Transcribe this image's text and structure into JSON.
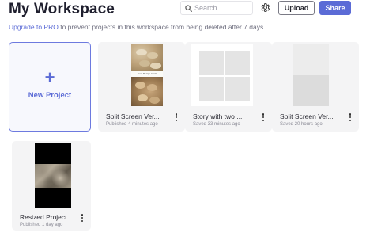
{
  "header": {
    "title": "My Workspace",
    "search_placeholder": "Search",
    "upload_label": "Upload",
    "share_label": "Share"
  },
  "notice": {
    "link_text": "Upgrade to PRO",
    "text": " to prevent projects in this workspace from being deleted after 7 days."
  },
  "new_project": {
    "plus": "+",
    "label": "New Project"
  },
  "projects": [
    {
      "name": "Split Screen Ver...",
      "meta": "Published 4 minutes ago",
      "thumb_caption": "How Recipe Alert!"
    },
    {
      "name": "Story with two ...",
      "meta": "Saved 33 minutes ago"
    },
    {
      "name": "Split Screen Ver...",
      "meta": "Saved 20 hours ago"
    },
    {
      "name": "Resized Project",
      "meta": "Published 1 day ago"
    }
  ],
  "colors": {
    "accent": "#5b6bd6",
    "card_bg": "#f4f4f5",
    "new_card_border": "#6d7adf"
  }
}
